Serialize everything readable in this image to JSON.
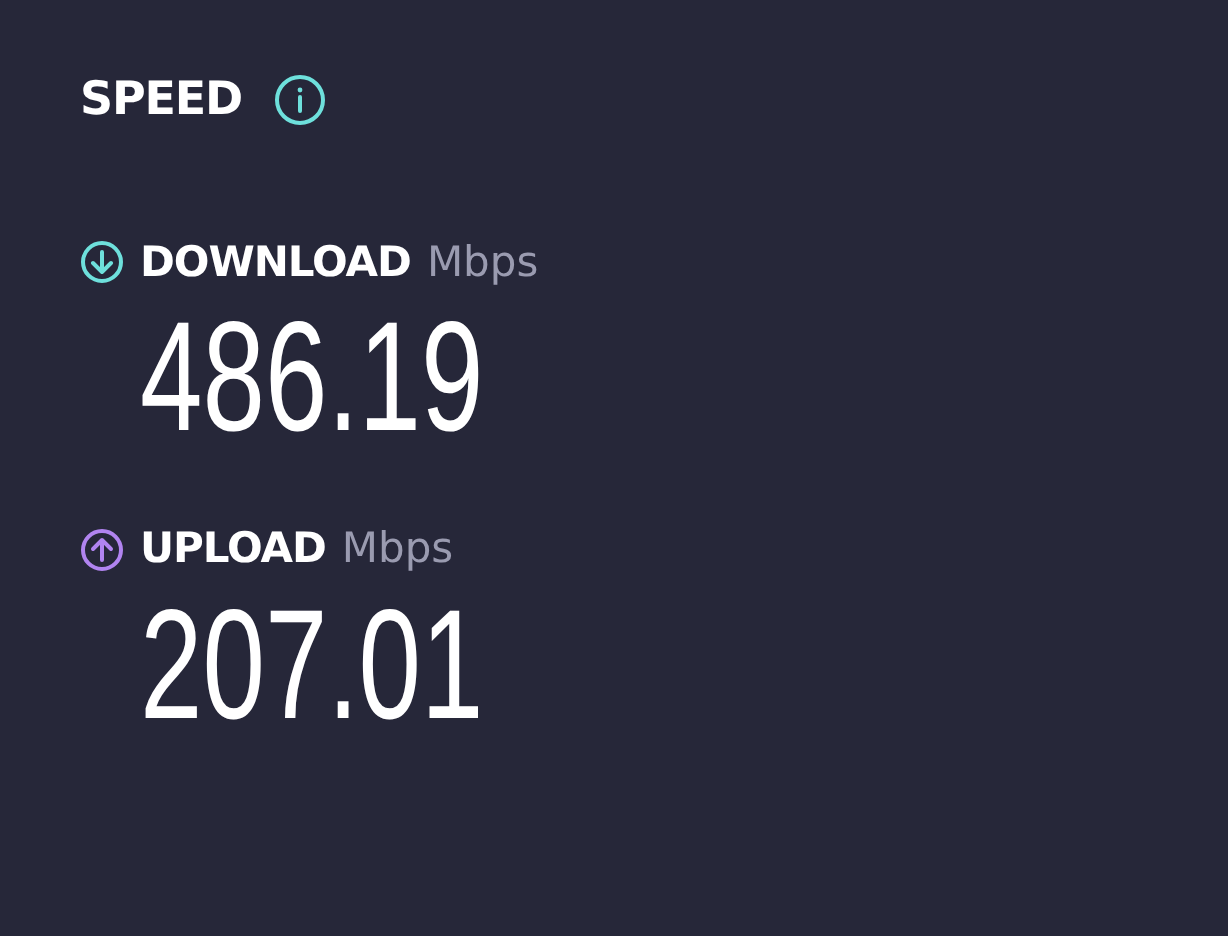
{
  "title": "SPEED",
  "metrics": [
    {
      "kind": "download",
      "label": "DOWNLOAD",
      "unit": "Mbps",
      "value": "486.19",
      "color": "#6ee0dc"
    },
    {
      "kind": "upload",
      "label": "UPLOAD",
      "unit": "Mbps",
      "value": "207.01",
      "color": "#b184f0"
    }
  ]
}
